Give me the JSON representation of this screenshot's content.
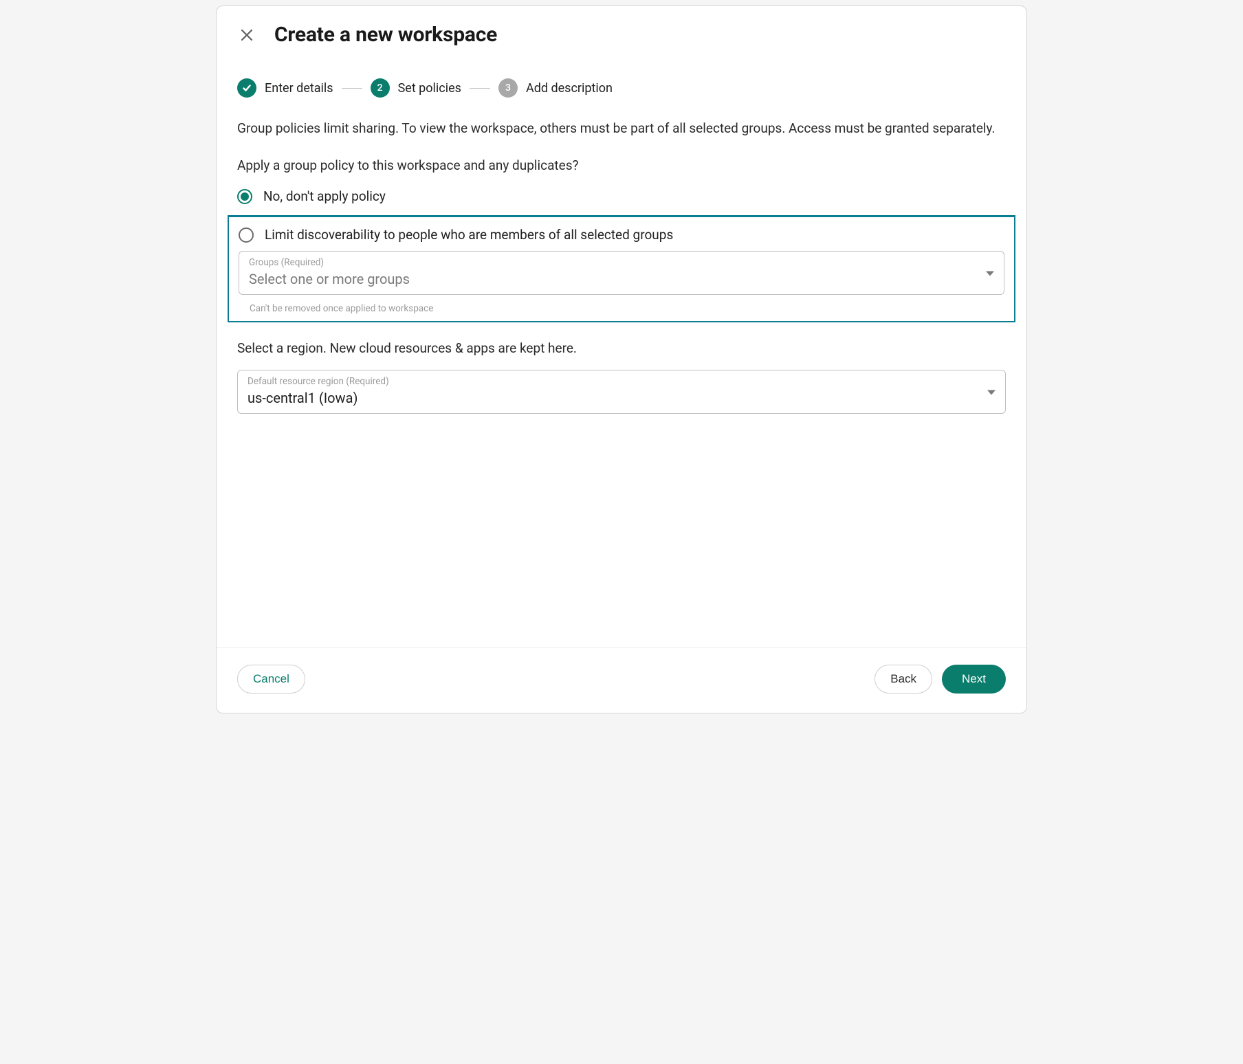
{
  "header": {
    "title": "Create a new workspace"
  },
  "stepper": {
    "steps": [
      {
        "label": "Enter details",
        "state": "done"
      },
      {
        "label": "Set policies",
        "state": "current",
        "number": "2"
      },
      {
        "label": "Add description",
        "state": "pending",
        "number": "3"
      }
    ]
  },
  "policy": {
    "description": "Group policies limit sharing. To view the workspace, others must be part of all selected groups. Access must be granted separately.",
    "prompt": "Apply a group policy to this workspace and any duplicates?",
    "options": {
      "none_label": "No, don't apply policy",
      "limit_label": "Limit discoverability to people who are members of all selected groups"
    },
    "groups_select": {
      "label": "Groups (Required)",
      "placeholder": "Select one or more groups",
      "hint": "Can't be removed once applied to workspace"
    }
  },
  "region": {
    "prompt": "Select a region. New cloud resources & apps are kept here.",
    "select": {
      "label": "Default resource region (Required)",
      "value": "us-central1 (Iowa)"
    }
  },
  "footer": {
    "cancel": "Cancel",
    "back": "Back",
    "next": "Next"
  }
}
